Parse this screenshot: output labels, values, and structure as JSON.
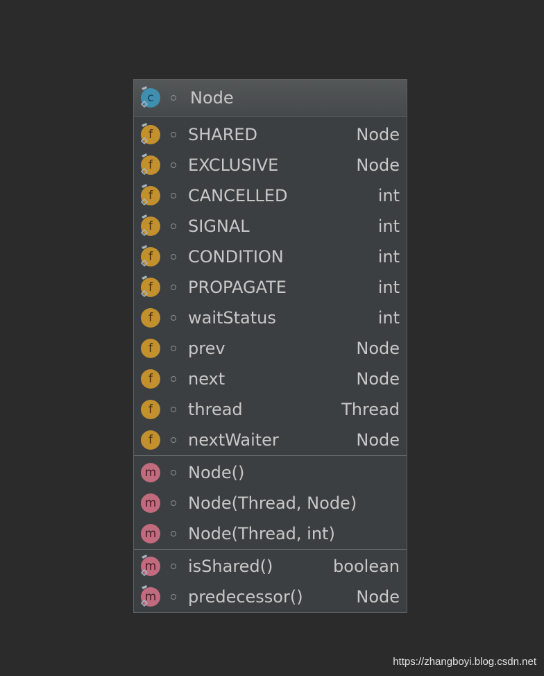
{
  "class": {
    "name": "Node",
    "kind_icon": "c",
    "icon": "class-icon"
  },
  "fields": [
    {
      "name": "SHARED",
      "type": "Node",
      "icon": "f",
      "final": true
    },
    {
      "name": "EXCLUSIVE",
      "type": "Node",
      "icon": "f",
      "final": true
    },
    {
      "name": "CANCELLED",
      "type": "int",
      "icon": "f",
      "final": true
    },
    {
      "name": "SIGNAL",
      "type": "int",
      "icon": "f",
      "final": true
    },
    {
      "name": "CONDITION",
      "type": "int",
      "icon": "f",
      "final": true
    },
    {
      "name": "PROPAGATE",
      "type": "int",
      "icon": "f",
      "final": true
    },
    {
      "name": "waitStatus",
      "type": "int",
      "icon": "f",
      "final": false
    },
    {
      "name": "prev",
      "type": "Node",
      "icon": "f",
      "final": false
    },
    {
      "name": "next",
      "type": "Node",
      "icon": "f",
      "final": false
    },
    {
      "name": "thread",
      "type": "Thread",
      "icon": "f",
      "final": false
    },
    {
      "name": "nextWaiter",
      "type": "Node",
      "icon": "f",
      "final": false
    }
  ],
  "constructors": [
    {
      "name": "Node()",
      "type": "",
      "icon": "m",
      "final": false
    },
    {
      "name": "Node(Thread, Node)",
      "type": "",
      "icon": "m",
      "final": false
    },
    {
      "name": "Node(Thread, int)",
      "type": "",
      "icon": "m",
      "final": false
    }
  ],
  "methods": [
    {
      "name": "isShared()",
      "type": "boolean",
      "icon": "m",
      "final": true
    },
    {
      "name": "predecessor()",
      "type": "Node",
      "icon": "m",
      "final": true
    }
  ],
  "watermark": "https://zhangboyi.blog.csdn.net",
  "colors": {
    "background": "#2b2b2b",
    "panel": "#3c3f41",
    "class_icon": "#3e8fb0",
    "field_icon": "#c3902e",
    "method_icon": "#c26b7f",
    "text": "#c8c8c8"
  }
}
